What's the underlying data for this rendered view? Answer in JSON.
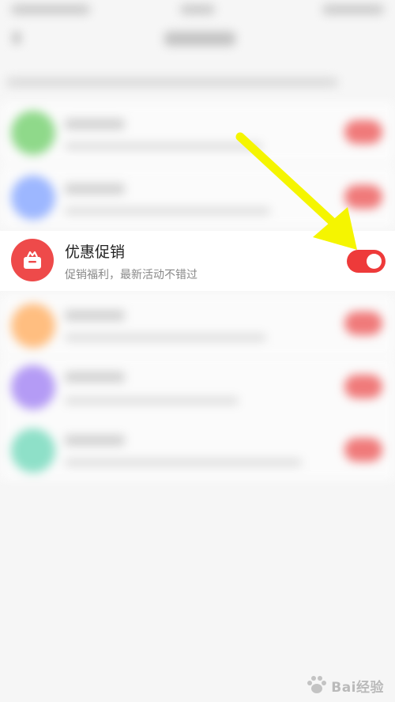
{
  "promo_row": {
    "title": "优惠促销",
    "subtitle": "促销福利，最新活动不错过",
    "toggle_on": true,
    "icon": "gift-icon"
  },
  "annotation": {
    "icon": "arrow-icon",
    "color": "#f5f500"
  },
  "watermark": {
    "text": "Bai经验",
    "icon": "paw-icon"
  },
  "colors": {
    "accent_red": "#ee3a3a",
    "icon_red": "#ee4a4a",
    "blur_green": "#8fd98a",
    "blur_blue": "#9db7ff",
    "blur_orange": "#ffbe80",
    "blur_purple": "#b49bf5",
    "blur_teal": "#8ee0c8"
  }
}
